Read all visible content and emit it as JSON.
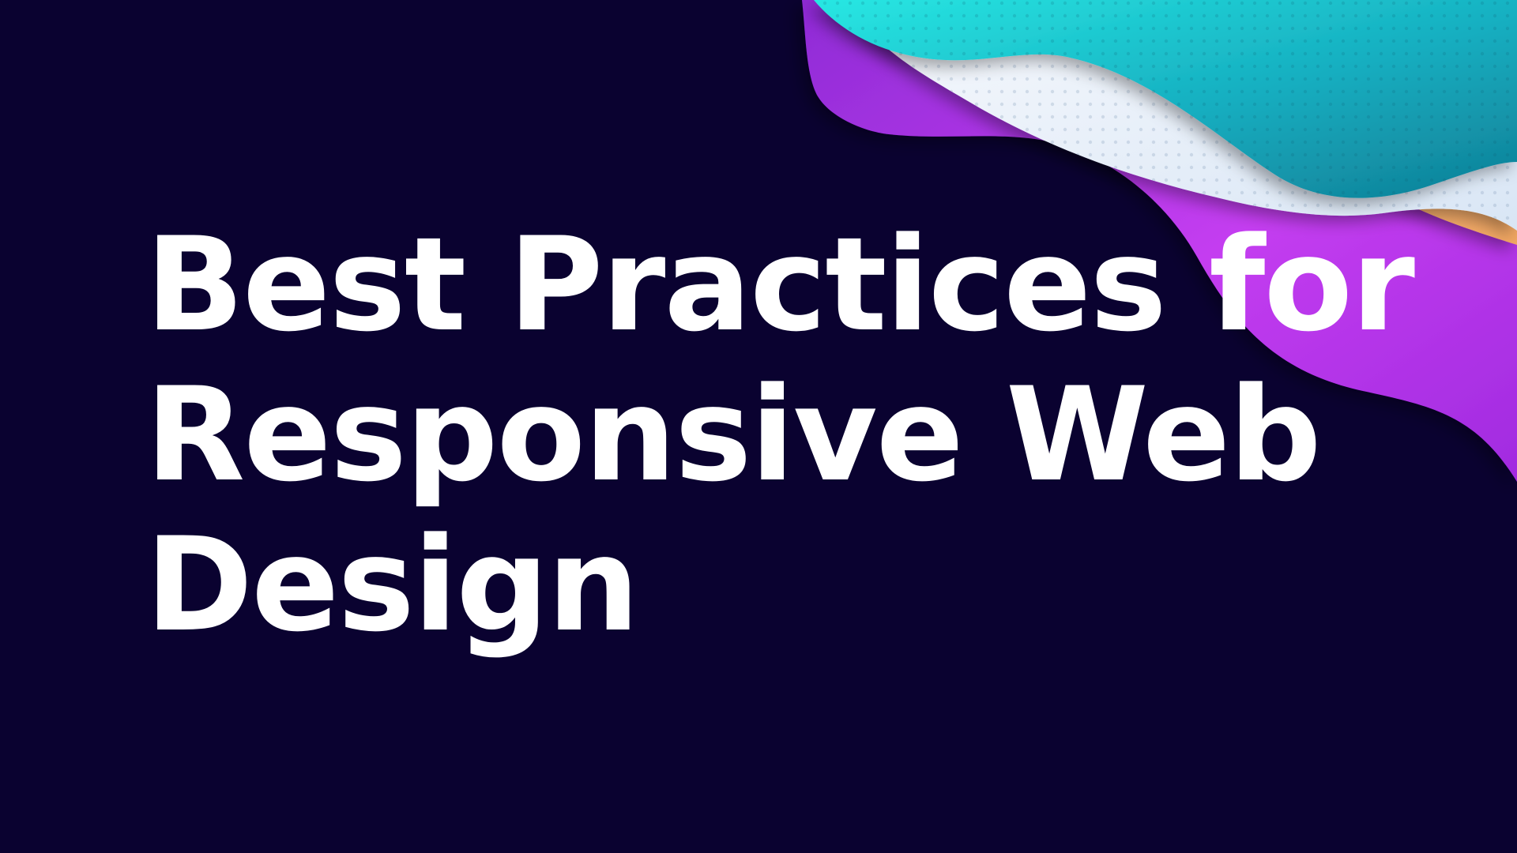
{
  "slide": {
    "background_color": "#0a0230",
    "title_lines": [
      "Best Practices for",
      "Responsive Web",
      "Design"
    ],
    "title_color": "#ffffff",
    "decoration": {
      "description": "layered wavy abstract shapes",
      "colors": {
        "purple": "#b22fe3",
        "orange": "#f7b57a",
        "white": "#e5edf7",
        "teal": "#1bbec8"
      }
    }
  }
}
